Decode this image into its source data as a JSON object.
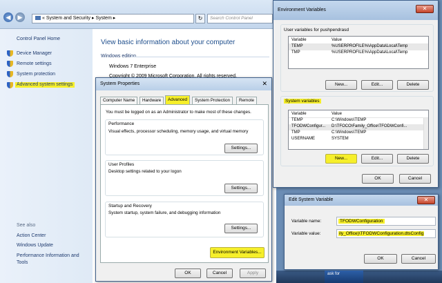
{
  "explorer": {
    "breadcrumb": [
      "System and Security",
      "System"
    ],
    "breadcrumb_prefix": "«",
    "search_placeholder": "Search Control Panel",
    "sidebar": {
      "home": "Control Panel Home",
      "links": [
        "Device Manager",
        "Remote settings",
        "System protection",
        "Advanced system settings"
      ],
      "see_also_title": "See also",
      "see_also": [
        "Action Center",
        "Windows Update",
        "Performance Information and Tools"
      ]
    },
    "main": {
      "title": "View basic information about your computer",
      "edition_header": "Windows edition",
      "edition": "Windows 7 Enterprise",
      "copyright": "Copyright © 2009 Microsoft Corporation.  All rights reserved."
    }
  },
  "system_properties": {
    "title": "System Properties",
    "tabs": [
      "Computer Name",
      "Hardware",
      "Advanced",
      "System Protection",
      "Remote"
    ],
    "active_tab": "Advanced",
    "admin_note": "You must be logged on as an Administrator to make most of these changes.",
    "performance": {
      "title": "Performance",
      "desc": "Visual effects, processor scheduling, memory usage, and virtual memory",
      "button": "Settings..."
    },
    "user_profiles": {
      "title": "User Profiles",
      "desc": "Desktop settings related to your logon",
      "button": "Settings..."
    },
    "startup": {
      "title": "Startup and Recovery",
      "desc": "System startup, system failure, and debugging information",
      "button": "Settings..."
    },
    "env_button": "Environment Variables...",
    "ok": "OK",
    "cancel": "Cancel",
    "apply": "Apply"
  },
  "env_vars": {
    "title": "Environment Variables",
    "user_label": "User variables for pushpendrasd",
    "col_variable": "Variable",
    "col_value": "Value",
    "user_rows": [
      {
        "name": "TEMP",
        "value": "%USERPROFILE%\\AppData\\Local\\Temp"
      },
      {
        "name": "TMP",
        "value": "%USERPROFILE%\\AppData\\Local\\Temp"
      }
    ],
    "system_label": "System variables",
    "system_rows": [
      {
        "name": "TEMP",
        "value": "C:\\Windows\\TEMP"
      },
      {
        "name": "TFODWConfigur...",
        "value": "D:\\TFOCO\\Family_Office\\TFODWConfi..."
      },
      {
        "name": "TMP",
        "value": "C:\\Windows\\TEMP"
      },
      {
        "name": "USERNAME",
        "value": "SYSTEM"
      }
    ],
    "new": "New...",
    "edit": "Edit...",
    "delete": "Delete",
    "ok": "OK",
    "cancel": "Cancel"
  },
  "edit_var": {
    "title": "Edit System Variable",
    "name_label": "Variable name:",
    "name_value": "TFODWConfiguration",
    "value_label": "Variable value:",
    "value_value": "ily_Office)\\TFODWConfiguration.dtsConfig",
    "ok": "OK",
    "cancel": "Cancel"
  },
  "ad": {
    "text": "ask for"
  },
  "colors": {
    "highlight": "#f6ef2a",
    "link": "#1e3a6e",
    "title_blue": "#1e4e8c"
  }
}
